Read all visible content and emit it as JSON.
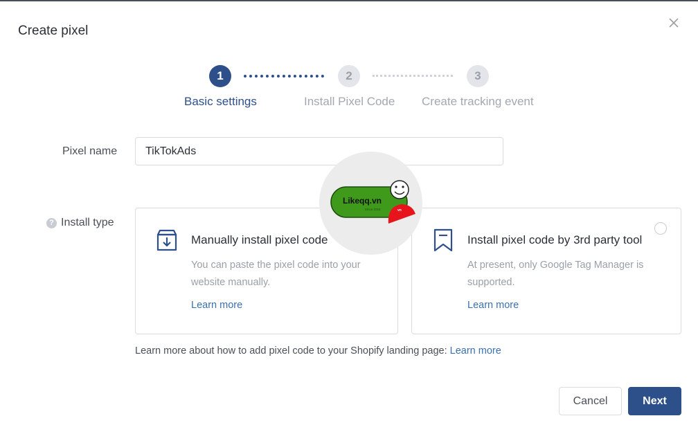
{
  "dialog": {
    "title": "Create pixel"
  },
  "steps": [
    {
      "number": "1",
      "label": "Basic settings",
      "state": "active"
    },
    {
      "number": "2",
      "label": "Install Pixel Code",
      "state": "inactive"
    },
    {
      "number": "3",
      "label": "Create tracking event",
      "state": "inactive"
    }
  ],
  "form": {
    "pixel_name_label": "Pixel name",
    "pixel_name_value": "TikTokAds",
    "install_type_label": "Install type",
    "help_icon": "?"
  },
  "install_options": [
    {
      "icon": "download-box-icon",
      "title": "Manually install pixel code",
      "description": "You can paste the pixel code into your website manually.",
      "link": "Learn more"
    },
    {
      "icon": "bookmark-icon",
      "title": "Install pixel code by 3rd party tool",
      "description": "At present, only Google Tag Manager is supported.",
      "link": "Learn more"
    }
  ],
  "footnote": {
    "text": "Learn more about how to add pixel code to your Shopify landing page:",
    "link": "Learn more"
  },
  "buttons": {
    "cancel": "Cancel",
    "next": "Next"
  },
  "watermark": {
    "brand": "Likeqq.vn",
    "tagline": "Since 2015",
    "badge": "vn"
  },
  "colors": {
    "primary": "#2d4f8a",
    "link": "#3a6fb0",
    "border": "#d9dce1",
    "muted_text": "#9aa0a8",
    "watermark_green": "#3f9a1c",
    "watermark_red": "#e8141b"
  }
}
